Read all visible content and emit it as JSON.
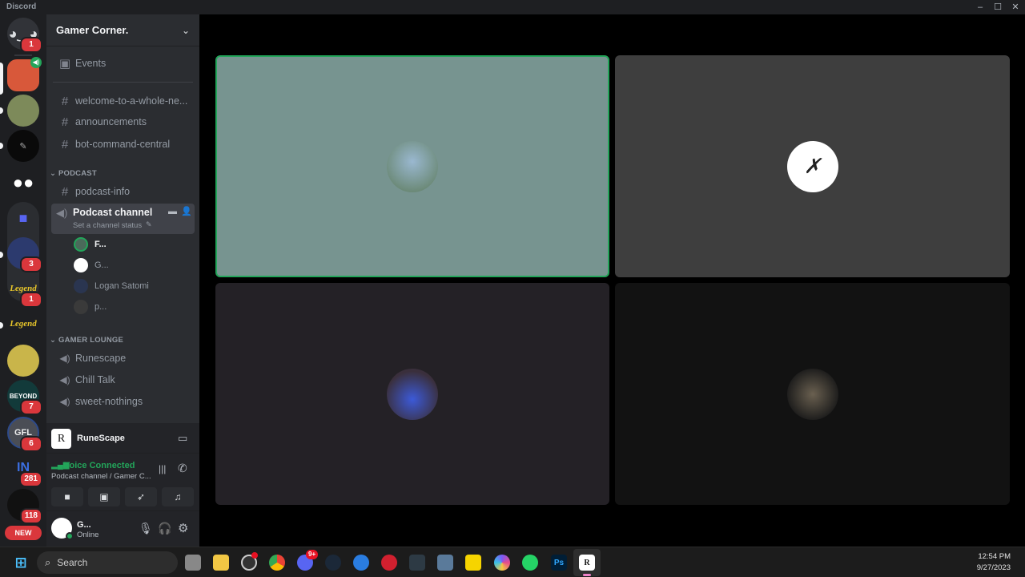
{
  "window": {
    "title": "Discord",
    "controls": {
      "minimize": "–",
      "maximize": "☐",
      "close": "✕"
    }
  },
  "server_rail": {
    "home": {
      "icon": "discord-logo-icon",
      "badge": "1"
    },
    "servers": [
      {
        "name": "fox-server",
        "badge": "",
        "status_icon": "speaker-icon",
        "selected": true
      },
      {
        "name": "geese-server",
        "badge": "",
        "unread": true
      },
      {
        "name": "sketch-server",
        "badge": "",
        "unread": true
      },
      {
        "name": "eyes-server",
        "badge": ""
      },
      {
        "name": "folder",
        "badge": ""
      },
      {
        "name": "frog-server",
        "badge": "3",
        "unread": true
      },
      {
        "name": "legend-server-1",
        "label": "Legend",
        "badge": "1"
      },
      {
        "name": "legend-server-2",
        "label": "Legend",
        "badge": "",
        "unread": true
      },
      {
        "name": "gem-server",
        "badge": ""
      },
      {
        "name": "beyond-server",
        "label": "BEYOND",
        "badge": "7"
      },
      {
        "name": "gfl-server",
        "label": "GFL",
        "badge": "6"
      },
      {
        "name": "in-server",
        "label": "IN",
        "badge": "281"
      },
      {
        "name": "ah-server",
        "badge": "118"
      }
    ],
    "new_label": "NEW"
  },
  "sidebar": {
    "guild_name": "Gamer Corner.",
    "events_label": "Events",
    "channels": [
      {
        "type": "text",
        "name": "welcome-to-a-whole-ne..."
      },
      {
        "type": "text",
        "name": "announcements"
      },
      {
        "type": "text",
        "name": "bot-command-central"
      }
    ],
    "categories": [
      {
        "name": "PODCAST",
        "channels": [
          {
            "type": "text",
            "name": "podcast-info"
          },
          {
            "type": "voice",
            "name": "Podcast channel",
            "status": "Set a channel status",
            "active": true,
            "members": [
              {
                "name": "F...",
                "speaking": true
              },
              {
                "name": "G..."
              },
              {
                "name": "Logan Satomi"
              },
              {
                "name": "p..."
              }
            ]
          }
        ]
      },
      {
        "name": "GAMER LOUNGE",
        "channels": [
          {
            "type": "voice",
            "name": "Runescape"
          },
          {
            "type": "voice",
            "name": "Chill Talk"
          },
          {
            "type": "voice",
            "name": "sweet-nothings"
          }
        ]
      }
    ]
  },
  "activity": {
    "name": "RuneScape"
  },
  "voice_panel": {
    "status": "Voice Connected",
    "location": "Podcast channel / Gamer C...",
    "status_color": "#23a55a",
    "buttons": [
      "camera",
      "screen-share",
      "activities",
      "soundboard"
    ]
  },
  "user_panel": {
    "name": "G...",
    "status": "Online"
  },
  "stage": {
    "tiles": [
      {
        "member": "F...",
        "bg": "#779490",
        "speaking": true
      },
      {
        "member": "G...",
        "bg": "#3e3e3e"
      },
      {
        "member": "Logan Satomi",
        "bg": "#242126"
      },
      {
        "member": "p...",
        "bg": "#121212"
      }
    ]
  },
  "taskbar": {
    "search_placeholder": "Search",
    "apps": [
      "start",
      "task-view",
      "file-explorer",
      "obs",
      "chrome",
      "discord",
      "steam",
      "app-blue",
      "app-red",
      "davinci",
      "calculator",
      "sticky-notes",
      "app-circle",
      "whatsapp",
      "photoshop",
      "runescape"
    ],
    "discord_badge": "9+",
    "time": "12:54 PM",
    "date": "9/27/2023"
  }
}
